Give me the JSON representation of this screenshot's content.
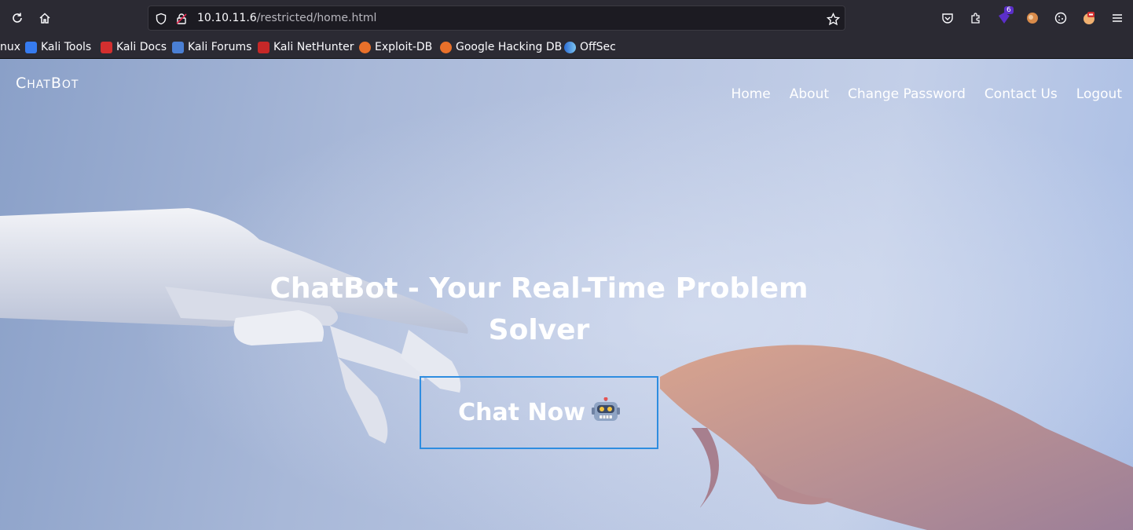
{
  "browser": {
    "url_host": "10.10.11.6",
    "url_path": "/restricted/home.html",
    "extension_badge_count": "6",
    "bookmarks": [
      {
        "label": "nux",
        "icon": "kali-linux-icon"
      },
      {
        "label": "Kali Tools",
        "icon": "kali-tools-icon"
      },
      {
        "label": "Kali Docs",
        "icon": "kali-docs-icon"
      },
      {
        "label": "Kali Forums",
        "icon": "kali-forums-icon"
      },
      {
        "label": "Kali NetHunter",
        "icon": "kali-nethunter-icon"
      },
      {
        "label": "Exploit-DB",
        "icon": "exploit-db-icon"
      },
      {
        "label": "Google Hacking DB",
        "icon": "google-hacking-db-icon"
      },
      {
        "label": "OffSec",
        "icon": "offsec-icon"
      }
    ]
  },
  "site": {
    "brand_first": "C",
    "brand_rest": "HAT",
    "brand_second": "B",
    "brand_rest2": "OT",
    "nav": [
      "Home",
      "About",
      "Change Password",
      "Contact Us",
      "Logout"
    ],
    "hero_title": "ChatBot - Your Real-Time Problem Solver",
    "cta_label": "Chat Now",
    "cta_emoji": "robot-emoji"
  },
  "colors": {
    "accent_border": "#2e8de0",
    "chrome_bg": "#2b2a33",
    "page_bg": "#b9c6e2"
  }
}
